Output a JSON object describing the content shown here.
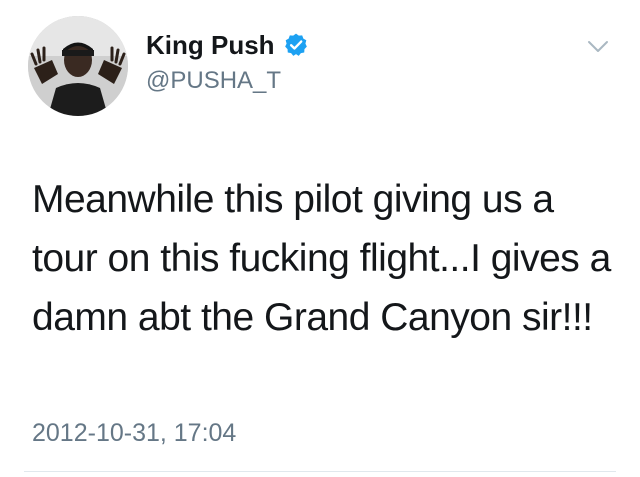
{
  "tweet": {
    "author": {
      "display_name": "King Push",
      "handle": "@PUSHA_T",
      "verified": true,
      "avatar_icon": "profile-photo"
    },
    "text": "Meanwhile this pilot giving us a tour on this fucking flight...I gives a damn abt the Grand Canyon sir!!!",
    "timestamp": "2012-10-31, 17:04"
  },
  "colors": {
    "text_primary": "#14171a",
    "text_secondary": "#657786",
    "verified_blue": "#1da1f2",
    "divider": "#e1e8ed"
  },
  "icons": {
    "verified": "verified-badge-icon",
    "menu": "chevron-down-icon"
  }
}
